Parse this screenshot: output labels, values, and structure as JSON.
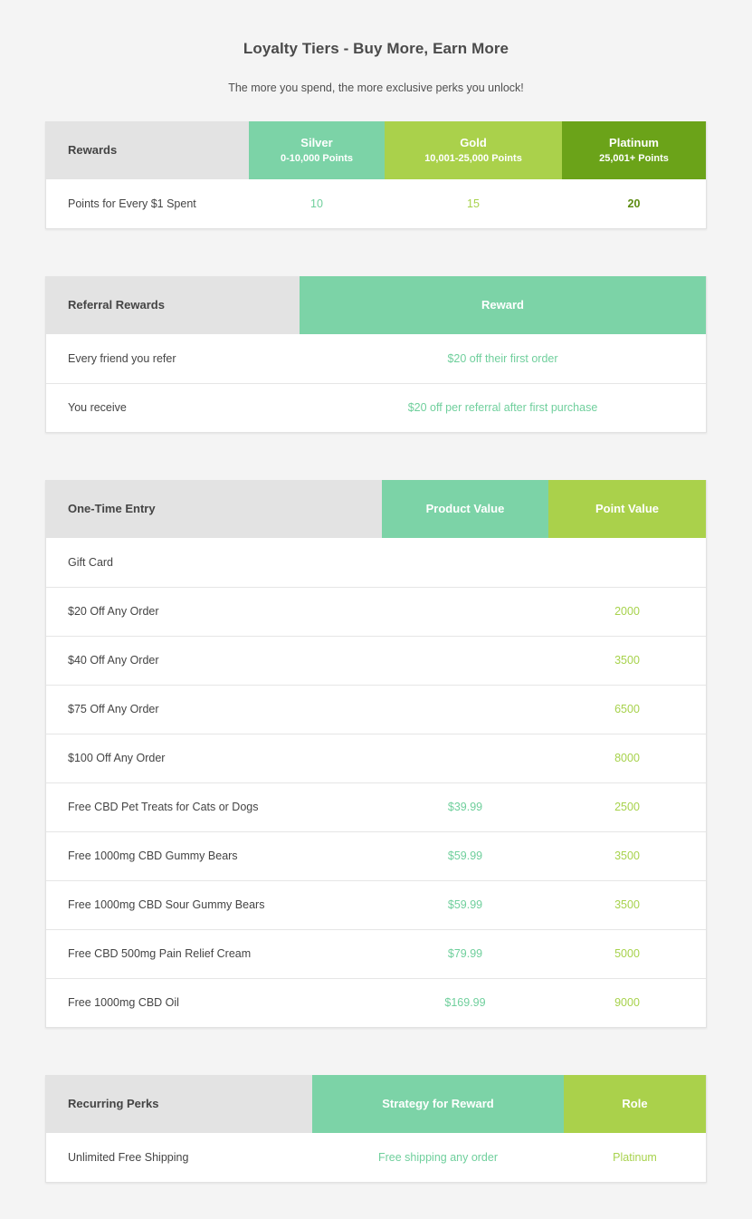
{
  "header": {
    "title": "Loyalty Tiers - Buy More, Earn More",
    "subtitle": "The more you spend, the more exclusive perks you unlock!"
  },
  "colors": {
    "teal": "#7cd3a7",
    "lime": "#aad14b",
    "olive": "#6ba319",
    "header_gray": "#e3e3e3",
    "page_bg": "#f4f4f4"
  },
  "tiers_table": {
    "label_header": "Rewards",
    "columns": [
      {
        "name": "Silver",
        "range": "0-10,000 Points"
      },
      {
        "name": "Gold",
        "range": "10,001-25,000 Points"
      },
      {
        "name": "Platinum",
        "range": "25,001+ Points"
      }
    ],
    "rows": [
      {
        "label": "Points for Every $1 Spent",
        "silver": "10",
        "gold": "15",
        "platinum": "20"
      }
    ]
  },
  "referral_table": {
    "label_header": "Referral Rewards",
    "value_header": "Reward",
    "rows": [
      {
        "label": "Every friend you refer",
        "reward": "$20 off their first order"
      },
      {
        "label": "You receive",
        "reward": "$20 off per referral after first purchase"
      }
    ]
  },
  "one_time_table": {
    "label_header": "One-Time Entry",
    "product_header": "Product Value",
    "point_header": "Point Value",
    "rows": [
      {
        "label": "Gift Card",
        "product_value": "",
        "point_value": ""
      },
      {
        "label": "$20 Off Any Order",
        "product_value": "",
        "point_value": "2000"
      },
      {
        "label": "$40 Off Any Order",
        "product_value": "",
        "point_value": "3500"
      },
      {
        "label": "$75 Off Any Order",
        "product_value": "",
        "point_value": "6500"
      },
      {
        "label": "$100 Off Any Order",
        "product_value": "",
        "point_value": "8000"
      },
      {
        "label": "Free CBD Pet Treats for Cats or Dogs",
        "product_value": "$39.99",
        "point_value": "2500"
      },
      {
        "label": "Free 1000mg CBD Gummy Bears",
        "product_value": "$59.99",
        "point_value": "3500"
      },
      {
        "label": "Free 1000mg CBD Sour Gummy Bears",
        "product_value": "$59.99",
        "point_value": "3500"
      },
      {
        "label": "Free CBD 500mg Pain Relief Cream",
        "product_value": "$79.99",
        "point_value": "5000"
      },
      {
        "label": "Free 1000mg CBD Oil",
        "product_value": "$169.99",
        "point_value": "9000"
      }
    ]
  },
  "recurring_table": {
    "label_header": "Recurring Perks",
    "strategy_header": "Strategy for Reward",
    "role_header": "Role",
    "rows": [
      {
        "label": "Unlimited Free Shipping",
        "strategy": "Free shipping any order",
        "role": "Platinum"
      }
    ]
  }
}
